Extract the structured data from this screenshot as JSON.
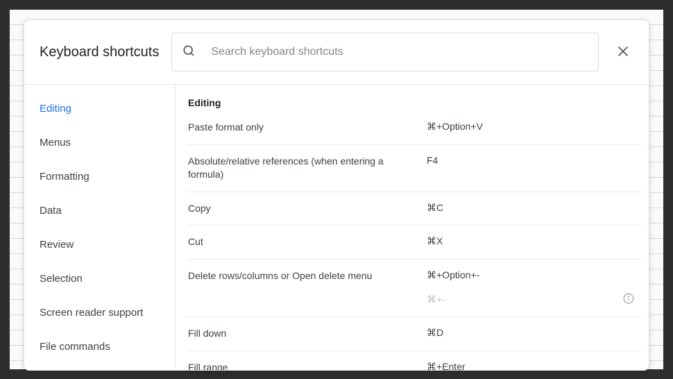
{
  "header": {
    "title": "Keyboard shortcuts",
    "search_placeholder": "Search keyboard shortcuts"
  },
  "sidebar": {
    "items": [
      {
        "label": "Editing",
        "active": true
      },
      {
        "label": "Menus",
        "active": false
      },
      {
        "label": "Formatting",
        "active": false
      },
      {
        "label": "Data",
        "active": false
      },
      {
        "label": "Review",
        "active": false
      },
      {
        "label": "Selection",
        "active": false
      },
      {
        "label": "Screen reader support",
        "active": false
      },
      {
        "label": "File commands",
        "active": false
      }
    ]
  },
  "section": {
    "title": "Editing",
    "shortcuts": [
      {
        "name": "Paste format only",
        "keys": [
          "⌘+Option+V"
        ]
      },
      {
        "name": "Absolute/relative references (when entering a formula)",
        "keys": [
          "F4"
        ]
      },
      {
        "name": "Copy",
        "keys": [
          "⌘C"
        ]
      },
      {
        "name": "Cut",
        "keys": [
          "⌘X"
        ]
      },
      {
        "name": "Delete rows/columns or Open delete menu",
        "keys": [
          "⌘+Option+-",
          "⌘+-"
        ],
        "dim_indices": [
          1
        ],
        "info": true
      },
      {
        "name": "Fill down",
        "keys": [
          "⌘D"
        ]
      },
      {
        "name": "Fill range",
        "keys": [
          "⌘+Enter"
        ]
      }
    ]
  }
}
